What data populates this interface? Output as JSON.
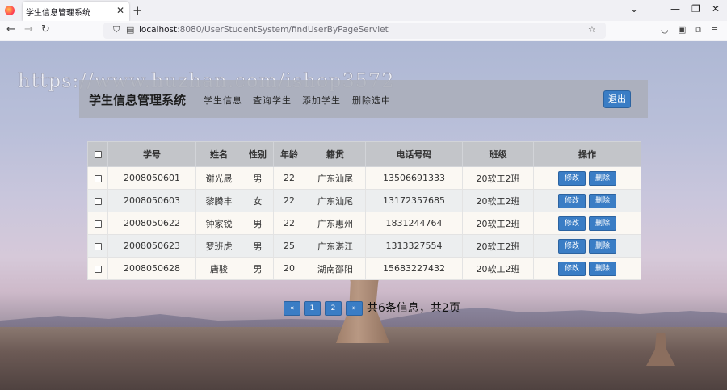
{
  "browser": {
    "tab_title": "学生信息管理系统",
    "url_host": "localhost",
    "url_path": ":8080/UserStudentSystem/findUserByPageServlet"
  },
  "watermark": "https://www.huzhan.com/ishop3572",
  "header": {
    "title": "学生信息管理系统",
    "menu": [
      "学生信息",
      "查询学生",
      "添加学生",
      "删除选中"
    ],
    "logout_label": "退出"
  },
  "table": {
    "columns": [
      "学号",
      "姓名",
      "性别",
      "年龄",
      "籍贯",
      "电话号码",
      "班级",
      "操作"
    ],
    "edit_label": "修改",
    "delete_label": "删除",
    "rows": [
      {
        "id": "2008050601",
        "name": "谢光晟",
        "gender": "男",
        "age": "22",
        "origin": "广东汕尾",
        "phone": "13506691333",
        "class": "20软工2班"
      },
      {
        "id": "2008050603",
        "name": "黎腾丰",
        "gender": "女",
        "age": "22",
        "origin": "广东汕尾",
        "phone": "13172357685",
        "class": "20软工2班"
      },
      {
        "id": "2008050622",
        "name": "钟家锐",
        "gender": "男",
        "age": "22",
        "origin": "广东惠州",
        "phone": "1831244764",
        "class": "20软工2班"
      },
      {
        "id": "2008050623",
        "name": "罗班虎",
        "gender": "男",
        "age": "25",
        "origin": "广东湛江",
        "phone": "1313327554",
        "class": "20软工2班"
      },
      {
        "id": "2008050628",
        "name": "唐骏",
        "gender": "男",
        "age": "20",
        "origin": "湖南邵阳",
        "phone": "15683227432",
        "class": "20软工2班"
      }
    ]
  },
  "pagination": {
    "prev": "«",
    "pages": [
      "1",
      "2"
    ],
    "next": "»",
    "info": "共6条信息，共2页"
  }
}
